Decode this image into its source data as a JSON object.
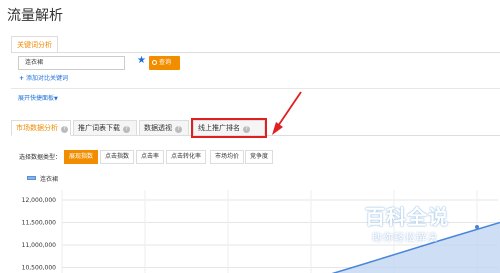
{
  "page": {
    "title": "流量解析"
  },
  "keyword_panel": {
    "tab_label": "关键词分析",
    "input_value": "连衣裙",
    "query_label": "查询",
    "add_compare_label": "添加对比关键词",
    "expand_label": "展开快捷面板"
  },
  "main_tabs": [
    {
      "label": "市场数据分析"
    },
    {
      "label": "推广词表下载"
    },
    {
      "label": "数据透视"
    },
    {
      "label": "线上推广排名"
    }
  ],
  "metrics": {
    "label": "选择数据类型：",
    "options": [
      "展现指数",
      "点击指数",
      "点击率",
      "点击转化率",
      "市场均价",
      "竞争度"
    ],
    "selected": "展现指数"
  },
  "chart": {
    "legend": "连衣裙",
    "accent": "#4a86d8"
  },
  "chart_data": {
    "type": "area",
    "series": [
      {
        "name": "连衣裙",
        "values": [
          10350000,
          10620000,
          11100000,
          11500000
        ]
      }
    ],
    "y_ticks": [
      "12,000,000",
      "11,500,000",
      "11,000,000",
      "10,500,000"
    ],
    "ylim": [
      10350000,
      12200000
    ],
    "grid": true
  },
  "watermark": {
    "title": "百科全说",
    "subtitle": "助你轻松解决"
  },
  "colors": {
    "accent_orange": "#f28d00",
    "link_blue": "#1e6fd8",
    "highlight_red": "#e02020"
  }
}
